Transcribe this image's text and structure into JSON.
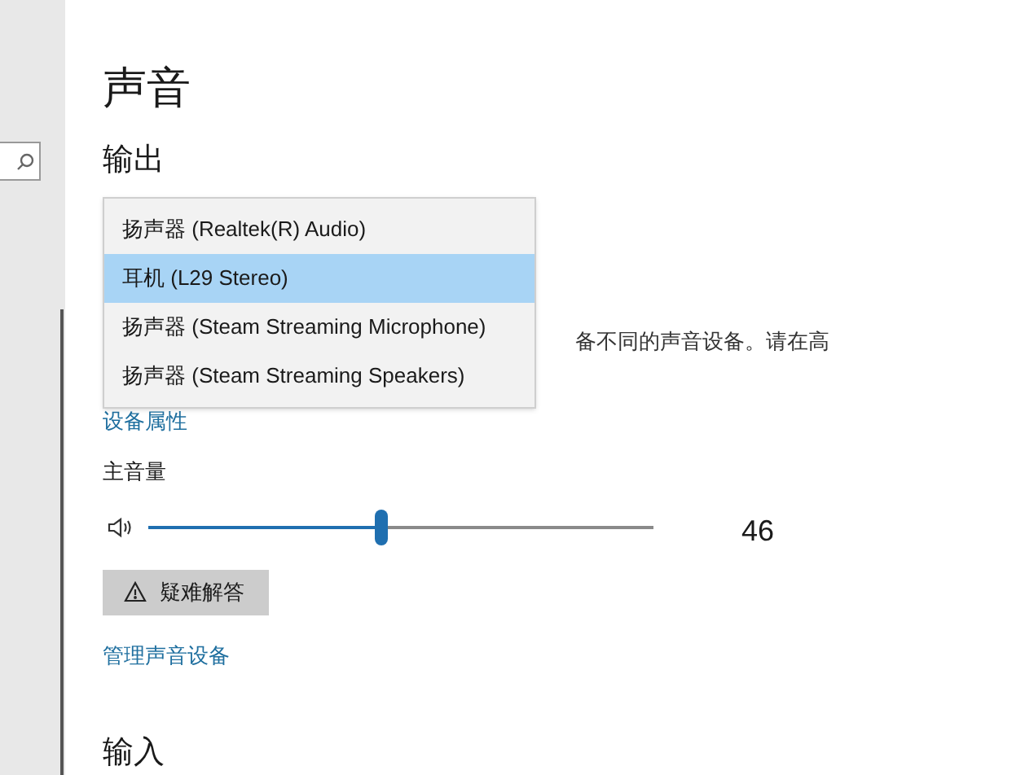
{
  "page": {
    "title": "声音"
  },
  "output": {
    "heading": "输出",
    "dropdown_options": [
      {
        "label": "扬声器 (Realtek(R) Audio)",
        "selected": false
      },
      {
        "label": "耳机 (L29  Stereo)",
        "selected": true
      },
      {
        "label": "扬声器 (Steam Streaming Microphone)",
        "selected": false
      },
      {
        "label": "扬声器 (Steam Streaming Speakers)",
        "selected": false
      }
    ],
    "description_visible_part": "备不同的声音设备。请在高",
    "device_properties_link": "设备属性",
    "volume": {
      "label": "主音量",
      "level": 0.46,
      "reading": "46"
    },
    "troubleshoot_button": "疑难解答",
    "manage_link": "管理声音设备"
  },
  "input": {
    "heading": "输入"
  }
}
